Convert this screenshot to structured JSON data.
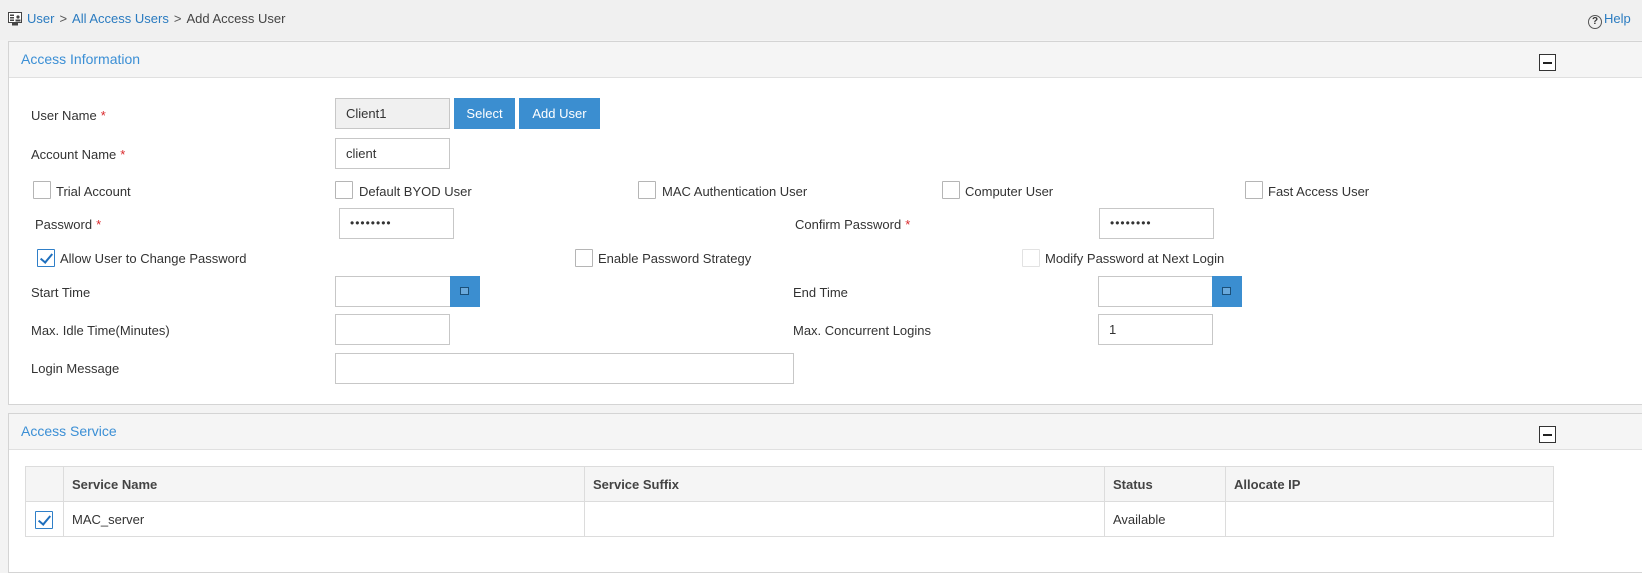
{
  "breadcrumb": {
    "items": [
      "User",
      "All Access Users",
      "Add Access User"
    ],
    "separator": ">"
  },
  "help": {
    "label": "Help"
  },
  "access_information": {
    "title": "Access Information",
    "user_name": {
      "label": "User Name",
      "required": "*",
      "value": "Client1",
      "select_label": "Select",
      "add_user_label": "Add User"
    },
    "account_name": {
      "label": "Account Name",
      "required": "*",
      "value": "client"
    },
    "account_types": [
      {
        "label": "Trial Account",
        "checked": false
      },
      {
        "label": "Default BYOD User",
        "checked": false
      },
      {
        "label": "MAC Authentication User",
        "checked": false
      },
      {
        "label": "Computer User",
        "checked": false
      },
      {
        "label": "Fast Access User",
        "checked": false
      }
    ],
    "password": {
      "label": "Password",
      "required": "*",
      "value": "••••••••"
    },
    "confirm_password": {
      "label": "Confirm Password",
      "required": "*",
      "value": "••••••••"
    },
    "allow_change_password": {
      "label": "Allow User to Change Password",
      "checked": true
    },
    "enable_password_strategy": {
      "label": "Enable Password Strategy",
      "checked": false
    },
    "modify_password_next_login": {
      "label": "Modify Password at Next Login",
      "checked": false,
      "disabled": true
    },
    "start_time": {
      "label": "Start Time",
      "value": ""
    },
    "end_time": {
      "label": "End Time",
      "value": ""
    },
    "max_idle_time": {
      "label": "Max. Idle Time(Minutes)",
      "value": ""
    },
    "max_concurrent_logins": {
      "label": "Max. Concurrent Logins",
      "value": "1"
    },
    "login_message": {
      "label": "Login Message",
      "value": ""
    }
  },
  "access_service": {
    "title": "Access Service",
    "columns": [
      "Service Name",
      "Service Suffix",
      "Status",
      "Allocate IP"
    ],
    "rows": [
      {
        "checked": true,
        "service_name": "MAC_server",
        "service_suffix": "",
        "status": "Available",
        "allocate_ip": ""
      }
    ]
  },
  "colors": {
    "accent": "#3b8ed0",
    "link": "#2a7bc0",
    "required": "#d9272a"
  }
}
